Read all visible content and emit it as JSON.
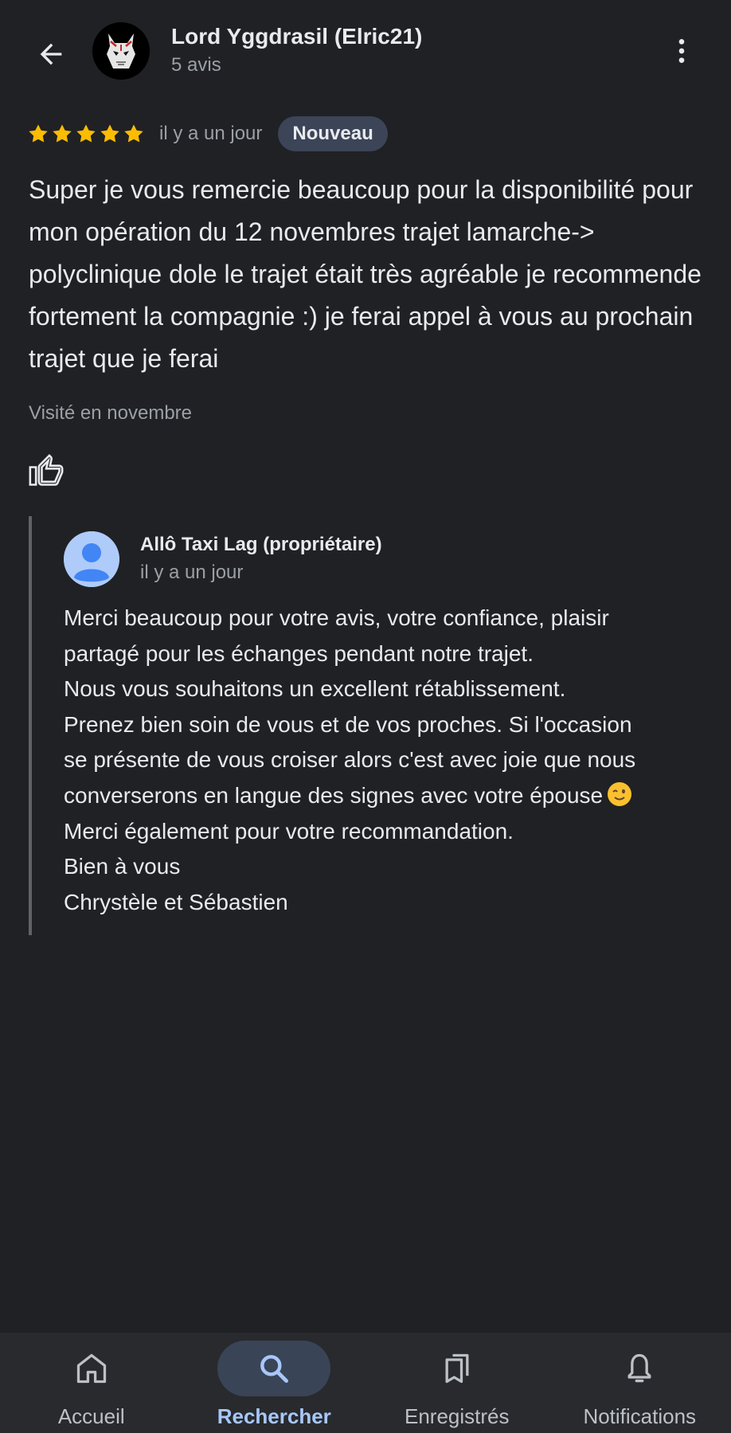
{
  "header": {
    "reviewer_name": "Lord Yggdrasil (Elric21)",
    "review_count": "5 avis",
    "back_icon": "arrow-back-icon",
    "more_icon": "more-vert-icon"
  },
  "review": {
    "rating": 5,
    "max_rating": 5,
    "star_color": "#fbbc04",
    "time": "il y a un jour",
    "badge": "Nouveau",
    "text": "Super je vous remercie beaucoup pour la disponibilité pour mon opération du 12 novembres trajet lamarche-> polyclinique dole le trajet était très agréable je recommende fortement la compagnie :) je ferai appel à vous au prochain trajet que je ferai",
    "visited": "Visité en novembre",
    "like_icon": "thumb-up-icon"
  },
  "owner_reply": {
    "name": "Allô Taxi Lag (propriétaire)",
    "time": "il y a un jour",
    "lines": [
      "Merci beaucoup pour votre avis, votre confiance, plaisir",
      "partagé pour les échanges pendant notre trajet.",
      "Nous vous souhaitons un excellent rétablissement.",
      "Prenez bien soin de vous et de vos proches. Si l'occasion",
      "se présente de vous croiser alors c'est avec joie que nous",
      "converserons en langue des signes avec votre épouse",
      "Merci également pour votre recommandation.",
      "Bien à vous",
      "Chrystèle et Sébastien"
    ],
    "emoji_icon": "winking-face-icon"
  },
  "bottom_nav": {
    "active": "Rechercher",
    "accent_color": "#a8c7fa",
    "items": [
      {
        "label": "Accueil",
        "icon": "home-icon"
      },
      {
        "label": "Rechercher",
        "icon": "search-icon"
      },
      {
        "label": "Enregistrés",
        "icon": "bookmarks-icon"
      },
      {
        "label": "Notifications",
        "icon": "bell-icon"
      }
    ]
  }
}
